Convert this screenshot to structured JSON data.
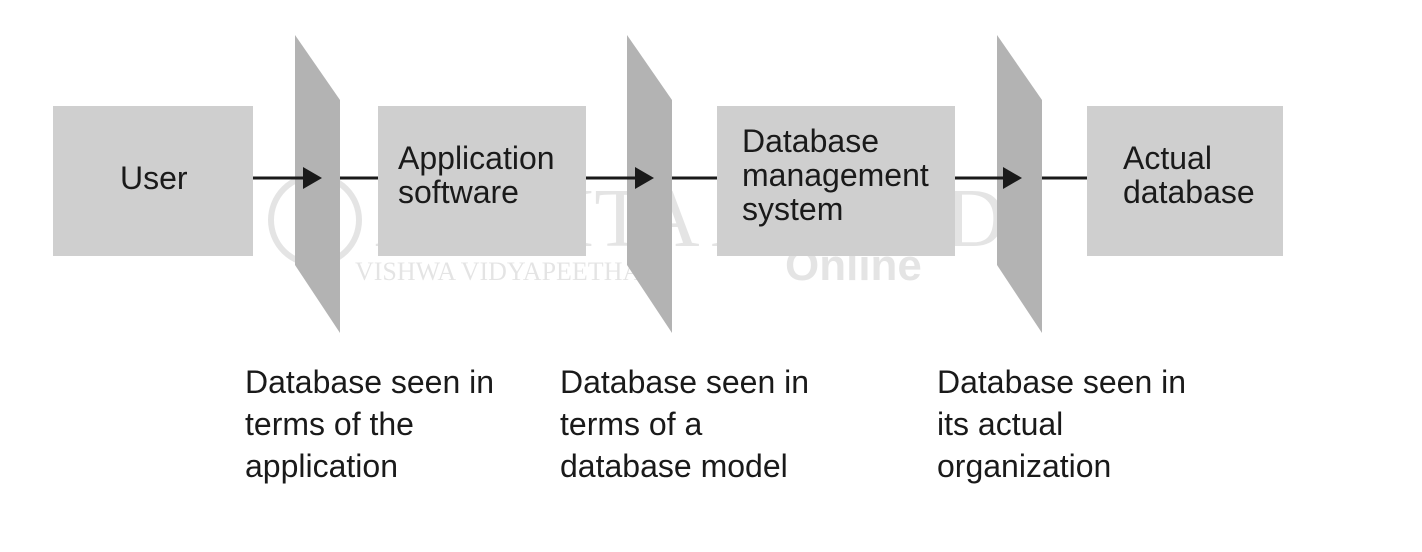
{
  "boxes": {
    "user": "User",
    "application": "Application\nsoftware",
    "dbms": "Database\nmanagement\nsystem",
    "actual_db": "Actual\ndatabase"
  },
  "captions": {
    "application_view": "Database seen in\nterms of the\napplication",
    "model_view": "Database seen in\nterms of a\ndatabase model",
    "actual_view": "Database seen in\nits actual\norganization"
  },
  "watermark": {
    "brand": "AMRITA AHEAD",
    "sub": "VISHWA VIDYAPEETHAM",
    "online": "Online"
  },
  "colors": {
    "box_fill": "#cfcfcf",
    "plane_fill": "#b3b3b3",
    "line": "#1a1a1a"
  }
}
